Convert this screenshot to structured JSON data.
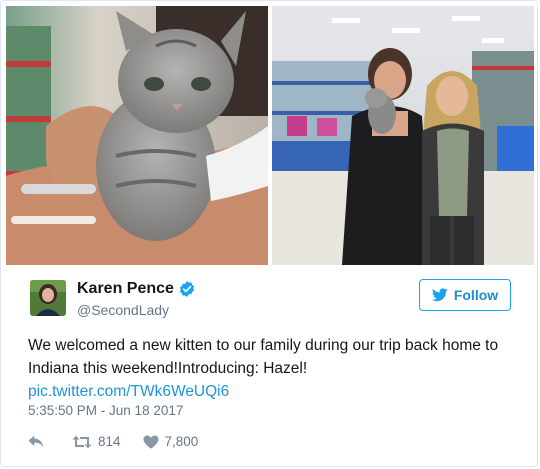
{
  "author": {
    "display_name": "Karen Pence",
    "handle": "@SecondLady",
    "verified": true
  },
  "follow_button": {
    "label": "Follow",
    "icon": "twitter-bird-icon"
  },
  "tweet": {
    "text_line1": "We welcomed a new kitten to our family during our trip back home to",
    "text_line2": "Indiana this weekend!Introducing: Hazel!",
    "link": "pic.twitter.com/TWk6WeUQi6",
    "timestamp": "5:35:50 PM - Jun 18 2017"
  },
  "actions": {
    "reply_icon": "reply-icon",
    "retweet_icon": "retweet-icon",
    "retweet_count": "814",
    "like_icon": "heart-icon",
    "like_count": "7,800"
  },
  "colors": {
    "brand_blue": "#1da1f2",
    "link_blue": "#1b95e0",
    "muted": "#657786"
  }
}
